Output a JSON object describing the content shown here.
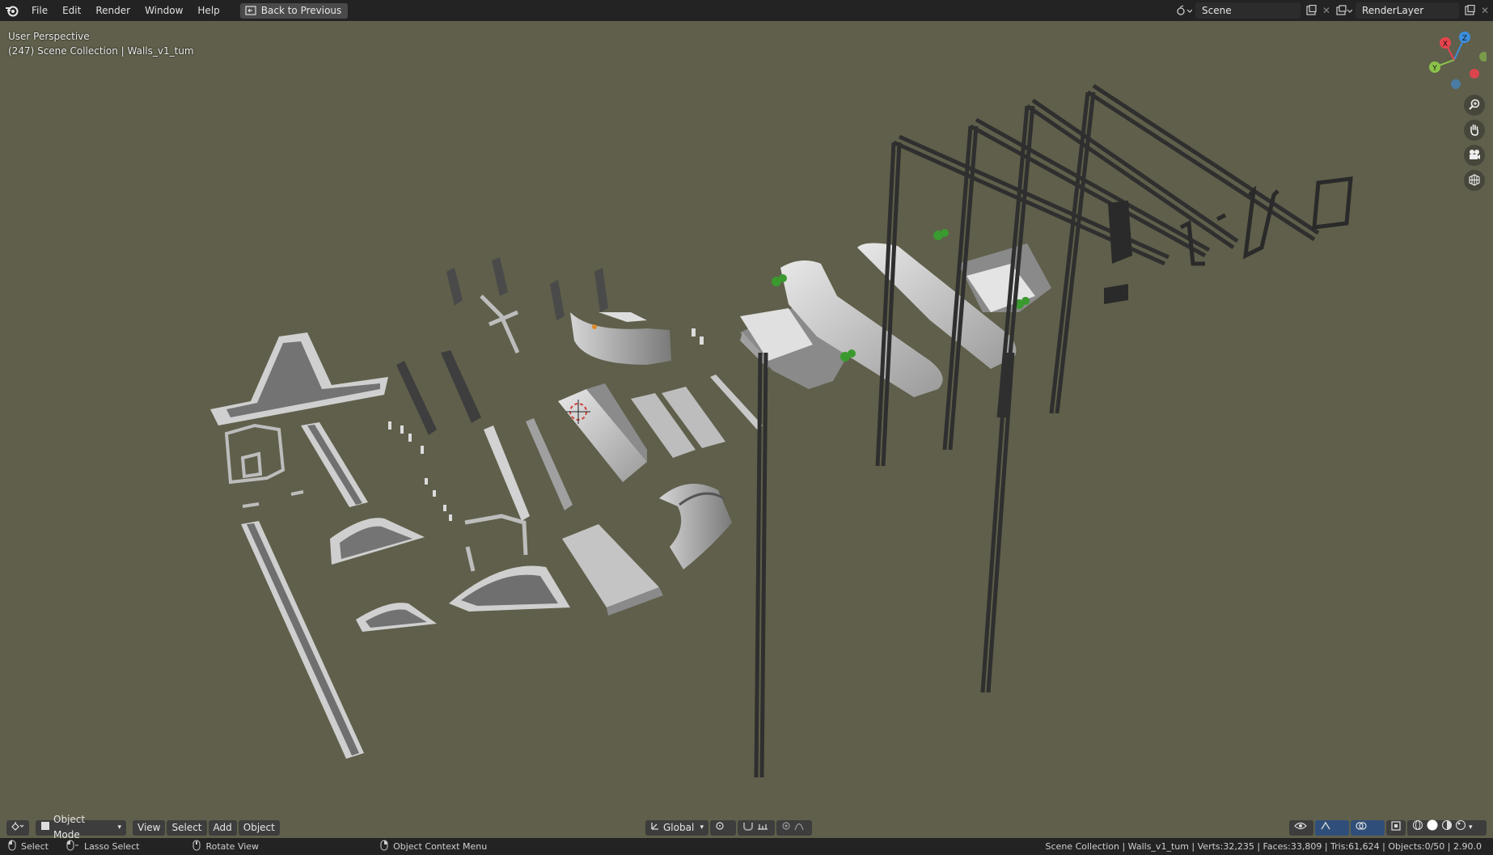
{
  "topbar": {
    "menus": [
      "File",
      "Edit",
      "Render",
      "Window",
      "Help"
    ],
    "back_button": "Back to Previous",
    "scene": "Scene",
    "render_layer": "RenderLayer"
  },
  "viewport": {
    "perspective": "User Perspective",
    "collection": "(247) Scene Collection | Walls_v1_tum",
    "gizmo": {
      "x_label": "X",
      "y_label": "Y",
      "z_label": "Z"
    }
  },
  "header": {
    "mode": "Object Mode",
    "menus": [
      "View",
      "Select",
      "Add",
      "Object"
    ],
    "transform_orientation": "Global"
  },
  "statusbar": {
    "select": "Select",
    "lasso": "Lasso Select",
    "rotate": "Rotate View",
    "context_menu": "Object Context Menu",
    "stats": "Scene Collection | Walls_v1_tum | Verts:32,235 | Faces:33,809 | Tris:61,624 | Objects:0/50 | 2.90.0"
  },
  "colors": {
    "viewport_bg": "#5f5f4b",
    "topbar_bg": "#232323",
    "axis_x": "#e8434e",
    "axis_y": "#8bc34a",
    "axis_z": "#3c8fe0"
  }
}
